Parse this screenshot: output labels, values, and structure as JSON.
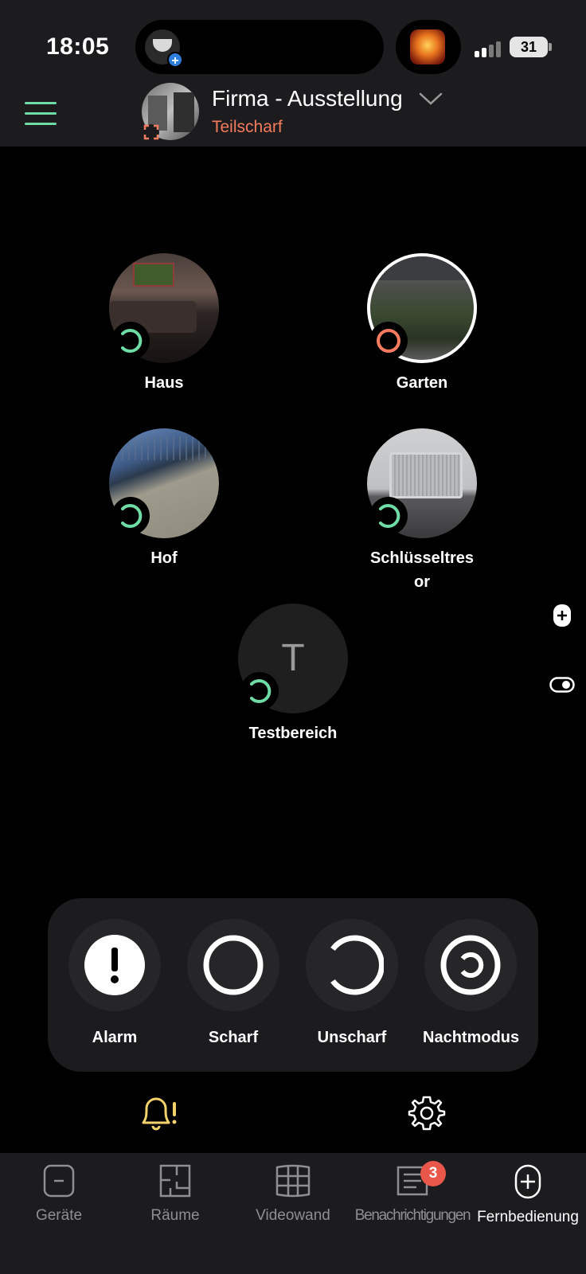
{
  "status_bar": {
    "time": "18:05",
    "battery": "31"
  },
  "header": {
    "site_name": "Firma - Ausstellung",
    "site_state": "Teilscharf",
    "state_color": "#f47b5e",
    "accent_color": "#6fdca5"
  },
  "zones": [
    {
      "name": "Haus",
      "status": "unarmed"
    },
    {
      "name": "Garten",
      "status": "armed"
    },
    {
      "name": "Hof",
      "status": "unarmed"
    },
    {
      "name": "Schlüsseltres",
      "name2": "or",
      "status": "unarmed"
    },
    {
      "name": "Testbereich",
      "initial": "T",
      "status": "unarmed"
    }
  ],
  "arm_controls": [
    {
      "label": "Alarm",
      "icon": "alarm-icon"
    },
    {
      "label": "Scharf",
      "icon": "armed-ring-icon"
    },
    {
      "label": "Unscharf",
      "icon": "disarmed-ring-icon"
    },
    {
      "label": "Nachtmodus",
      "icon": "night-mode-icon"
    }
  ],
  "tabbar": {
    "items": [
      {
        "label": "Geräte",
        "icon": "device-icon"
      },
      {
        "label": "Räume",
        "icon": "rooms-icon"
      },
      {
        "label": "Videowand",
        "icon": "video-wall-icon"
      },
      {
        "label": "Benachrichtigungen",
        "icon": "notifications-icon",
        "badge": "3"
      },
      {
        "label": "Fernbedienung",
        "icon": "remote-control-icon",
        "active": true
      }
    ]
  }
}
